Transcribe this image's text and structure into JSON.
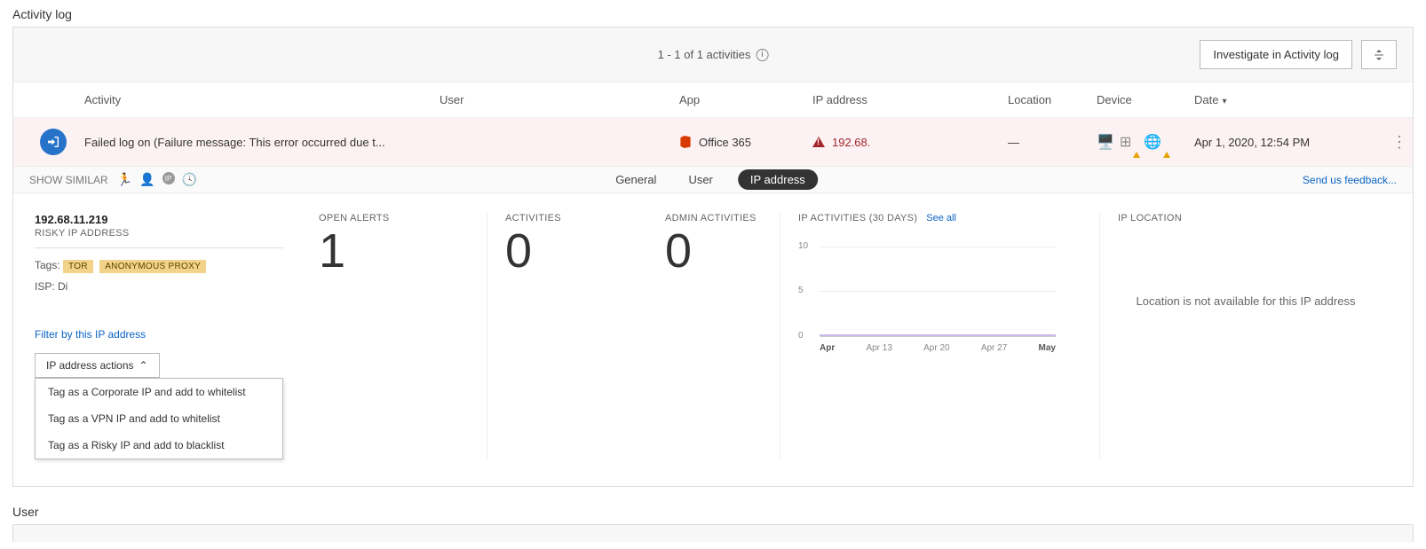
{
  "section_title": "Activity log",
  "header": {
    "range_text": "1 - 1 of 1 activities",
    "investigate_label": "Investigate in Activity log"
  },
  "columns": {
    "activity": "Activity",
    "user": "User",
    "app": "App",
    "ip": "IP address",
    "location": "Location",
    "device": "Device",
    "date": "Date"
  },
  "row": {
    "activity": "Failed log on (Failure message: This error occurred due t...",
    "user": "",
    "app": "Office 365",
    "ip": "192.68.",
    "location": "—",
    "date": "Apr 1, 2020, 12:54 PM"
  },
  "detail_tabs": {
    "show_similar": "SHOW SIMILAR",
    "tabs": {
      "general": "General",
      "user": "User",
      "ip": "IP address"
    },
    "feedback": "Send us feedback..."
  },
  "ip_detail": {
    "ip_full": "192.68.11.219",
    "risky_label": "RISKY IP ADDRESS",
    "tags_label": "Tags:",
    "tag1": "TOR",
    "tag2": "ANONYMOUS PROXY",
    "isp": "ISP: Di",
    "filter_link": "Filter by this IP address",
    "actions_label": "IP address actions",
    "menu1": "Tag as a Corporate IP and add to whitelist",
    "menu2": "Tag as a VPN IP and add to whitelist",
    "menu3": "Tag as a Risky IP and add to blacklist"
  },
  "stats": {
    "open_alerts_label": "OPEN ALERTS",
    "open_alerts_value": "1",
    "activities_label": "ACTIVITIES",
    "activities_value": "0",
    "admin_label": "ADMIN ACTIVITIES",
    "admin_value": "0"
  },
  "chart": {
    "title": "IP ACTIVITIES (30 DAYS)",
    "see_all": "See all",
    "y10": "10",
    "y5": "5",
    "y0": "0",
    "x_apr": "Apr",
    "x_13": "Apr 13",
    "x_20": "Apr 20",
    "x_27": "Apr 27",
    "x_may": "May"
  },
  "chart_data": {
    "type": "line",
    "title": "IP ACTIVITIES (30 DAYS)",
    "xlabel": "",
    "ylabel": "",
    "ylim": [
      0,
      10
    ],
    "x_ticks": [
      "Apr",
      "Apr 13",
      "Apr 20",
      "Apr 27",
      "May"
    ],
    "y_ticks": [
      0,
      5,
      10
    ],
    "series": [
      {
        "name": "IP activities",
        "x": [
          "Apr",
          "Apr 13",
          "Apr 20",
          "Apr 27",
          "May"
        ],
        "values": [
          0,
          0,
          0,
          0,
          0
        ]
      }
    ]
  },
  "location_block": {
    "title": "IP LOCATION",
    "msg": "Location is not available for this IP address"
  },
  "user_section": "User"
}
